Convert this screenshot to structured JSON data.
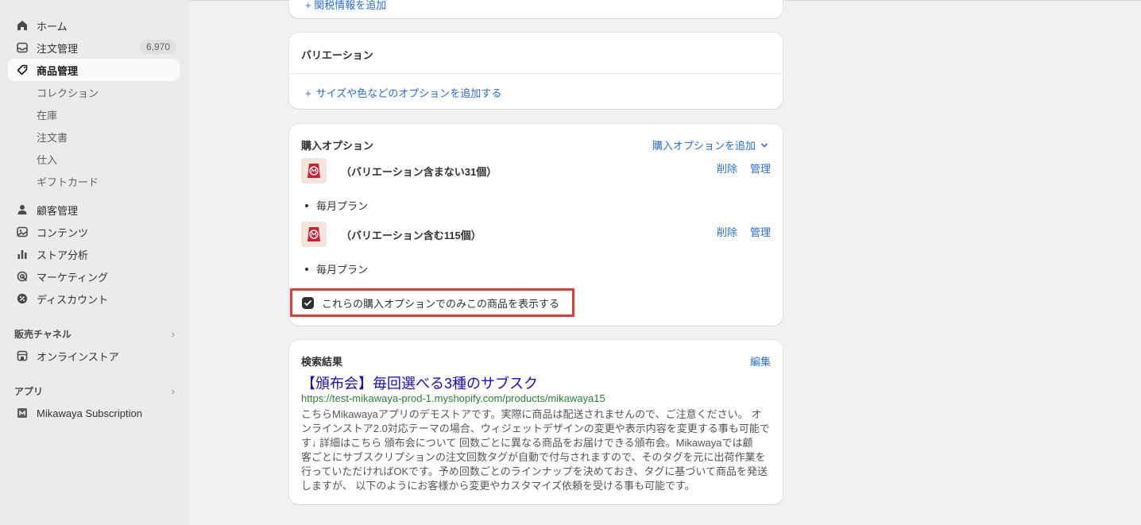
{
  "sidebar": {
    "home": "ホーム",
    "orders": "注文管理",
    "orders_badge": "6,970",
    "products": "商品管理",
    "sub_collections": "コレクション",
    "sub_inventory": "在庫",
    "sub_purchase_orders": "注文書",
    "sub_transfers": "仕入",
    "sub_gift_cards": "ギフトカード",
    "customers": "顧客管理",
    "content": "コンテンツ",
    "analytics": "ストア分析",
    "marketing": "マーケティング",
    "discounts": "ディスカウント",
    "sales_channels_header": "販売チャネル",
    "online_store": "オンラインストア",
    "apps_header": "アプリ",
    "app_mikawaya": "Mikawaya Subscription"
  },
  "top_card": {
    "add_related_info": "関税情報を追加"
  },
  "variation_card": {
    "title": "バリエーション",
    "add_option": "サイズや色などのオプションを追加する"
  },
  "purchase_options": {
    "title": "購入オプション",
    "add_link": "購入オプションを追加",
    "plans": [
      {
        "name": "（バリエーション含まない31個）",
        "delete": "削除",
        "manage": "管理",
        "item": "毎月プラン"
      },
      {
        "name": "（バリエーション含む115個）",
        "delete": "削除",
        "manage": "管理",
        "item": "毎月プラン"
      }
    ],
    "checkbox_label": "これらの購入オプションでのみこの商品を表示する",
    "checkbox_checked": true
  },
  "seo": {
    "title": "検索結果",
    "edit": "編集",
    "page_title": "【頒布会】毎回選べる3種のサブスク",
    "url": "https://test-mikawaya-prod-1.myshopify.com/products/mikawaya15",
    "desc_lines": [
      "こちらMikawayaアプリのデモストアです。実際に商品は配送されませんので、ご注意ください。 オ",
      "ンラインストア2.0対応テーマの場合、ウィジェットデザインの変更や表示内容を変更する事も可能で",
      "す↓ 詳細はこちら 頒布会について 回数ごとに異なる商品をお届けできる頒布会。Mikawayaでは顧",
      "客ごとにサブスクリプションの注文回数タグが自動で付与されますので、そのタグを元に出荷作業を",
      "行っていただければOKです。予め回数ごとのラインナップを決めておき、タグに基づいて商品を発送",
      "しますが、 以下のようにお客様から変更やカスタマイズ依頼を受ける事も可能です。"
    ]
  },
  "colors": {
    "link": "#2c6ecb",
    "highlight": "#e03b35",
    "seo_title": "#1a0dab",
    "seo_url": "#2a7e35"
  }
}
